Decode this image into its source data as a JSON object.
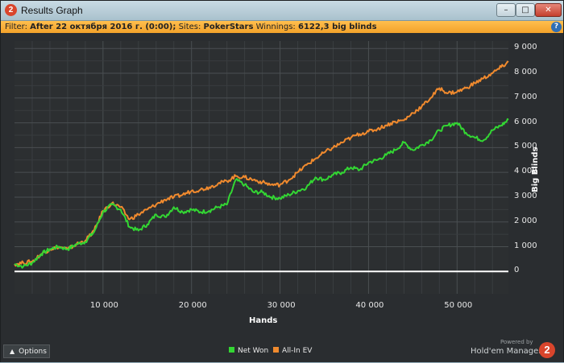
{
  "window": {
    "title": "Results Graph",
    "app_icon": "2",
    "buttons": {
      "min": "–",
      "max": "□",
      "close": "✕"
    }
  },
  "filter": {
    "prefix": "Filter:",
    "date": "After 22 октября 2016 г. (0:00);",
    "sites_label": "Sites:",
    "sites_value": "PokerStars",
    "winnings_label": "Winnings:",
    "winnings_value": "6122,3 big blinds"
  },
  "help_icon": "?",
  "options_label": "Options",
  "powered_by": "Powered by",
  "brand": "Hold'em Manager",
  "brand_badge": "2",
  "colors": {
    "net_won": "#33d633",
    "all_in_ev": "#f08a2e",
    "zero_line": "#ffffff",
    "accent": "#f5ab30"
  },
  "chart_data": {
    "type": "line",
    "xlabel": "Hands",
    "ylabel": "Big Blinds",
    "xlim": [
      0,
      55800
    ],
    "ylim": [
      -900,
      9300
    ],
    "x_ticks": [
      10000,
      20000,
      30000,
      40000,
      50000
    ],
    "x_tick_labels": [
      "10 000",
      "20 000",
      "30 000",
      "40 000",
      "50 000"
    ],
    "y_ticks": [
      0,
      1000,
      2000,
      3000,
      4000,
      5000,
      6000,
      7000,
      8000,
      9000
    ],
    "y_tick_labels": [
      "0",
      "1 000",
      "2 000",
      "3 000",
      "4 000",
      "5 000",
      "6 000",
      "7 000",
      "8 000",
      "9 000"
    ],
    "grid": true,
    "legend": "bottom-center",
    "x": [
      0,
      1000,
      2000,
      3000,
      4000,
      5000,
      6000,
      7000,
      8000,
      9000,
      10000,
      11000,
      12000,
      13000,
      14000,
      15000,
      16000,
      17000,
      18000,
      19000,
      20000,
      21000,
      22000,
      23000,
      24000,
      25000,
      26000,
      27000,
      28000,
      29000,
      30000,
      31000,
      32000,
      33000,
      34000,
      35000,
      36000,
      37000,
      38000,
      39000,
      40000,
      41000,
      42000,
      43000,
      44000,
      45000,
      46000,
      47000,
      48000,
      49000,
      50000,
      51000,
      52000,
      53000,
      54000,
      55000,
      55800
    ],
    "series": [
      {
        "name": "Net Won",
        "values": [
          300,
          200,
          350,
          700,
          900,
          1000,
          900,
          1100,
          1200,
          1600,
          2400,
          2700,
          2500,
          1800,
          1650,
          1900,
          2300,
          2200,
          2600,
          2400,
          2500,
          2400,
          2450,
          2600,
          2700,
          3700,
          3500,
          3200,
          3200,
          3000,
          2950,
          3100,
          3250,
          3400,
          3800,
          3700,
          3900,
          4000,
          4200,
          4100,
          4400,
          4500,
          4700,
          4900,
          5200,
          4900,
          5100,
          5300,
          5700,
          5900,
          6000,
          5600,
          5400,
          5300,
          5700,
          5900,
          6120
        ]
      },
      {
        "name": "All-In EV",
        "values": [
          300,
          350,
          400,
          700,
          900,
          1000,
          900,
          1100,
          1250,
          1650,
          2450,
          2750,
          2600,
          2100,
          2300,
          2500,
          2700,
          2900,
          3000,
          3100,
          3250,
          3300,
          3400,
          3550,
          3650,
          3850,
          3800,
          3700,
          3600,
          3500,
          3500,
          3700,
          4000,
          4300,
          4550,
          4800,
          5000,
          5200,
          5400,
          5550,
          5650,
          5750,
          5900,
          6050,
          6100,
          6400,
          6650,
          7000,
          7400,
          7200,
          7250,
          7400,
          7600,
          7800,
          8000,
          8250,
          8450
        ]
      }
    ]
  }
}
